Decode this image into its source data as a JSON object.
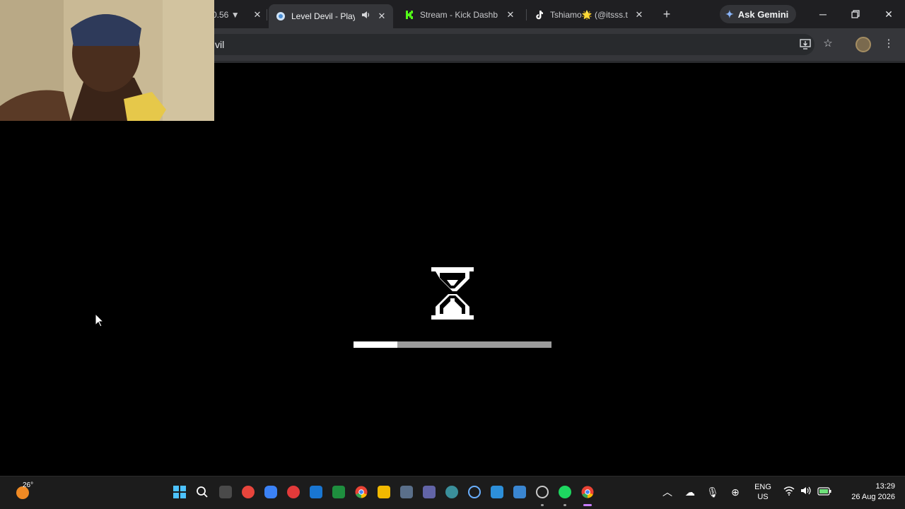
{
  "browser": {
    "tabs": [
      {
        "title": "0.56 ▼",
        "active": false
      },
      {
        "title": "Level Devil - Play",
        "active": true
      },
      {
        "title": "Stream - Kick Dashbo",
        "active": false
      },
      {
        "title": "Tshiamo🌟 (@itsss.t",
        "active": false
      }
    ],
    "ask_gemini_label": "Ask Gemini",
    "address_bar_text": "vil"
  },
  "page": {
    "loading_progress_percent": 22
  },
  "taskbar": {
    "weather_temp": "26°",
    "language_line1": "ENG",
    "language_line2": "US",
    "time": "13:29",
    "date": "26 Aug 2026"
  },
  "colors": {
    "tabstrip_bg": "#1f1f22",
    "toolbar_bg": "#35363a",
    "page_bg": "#000000",
    "progress_fill": "#ffffff",
    "progress_track": "#9c9c9c",
    "taskbar_bg": "#1c1c1c"
  }
}
